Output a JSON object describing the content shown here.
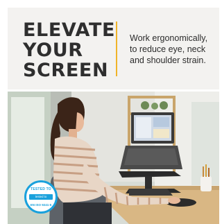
{
  "headline": {
    "line1": "ELEVATE",
    "line2": "YOUR",
    "line3": "SCREEN"
  },
  "subtext": {
    "line1": "Work ergonomically,",
    "line2": "to reduce eye, neck",
    "line3": "and shoulder strain."
  },
  "badge": {
    "top": "TESTED TO",
    "middle": "tested to international",
    "bottom": "EN ISO 9241-5"
  },
  "colors": {
    "accent": "#f0b429",
    "headline": "#2e2e2e",
    "badge": "#1aa1dc",
    "header_bg": "#f3f2f0"
  }
}
